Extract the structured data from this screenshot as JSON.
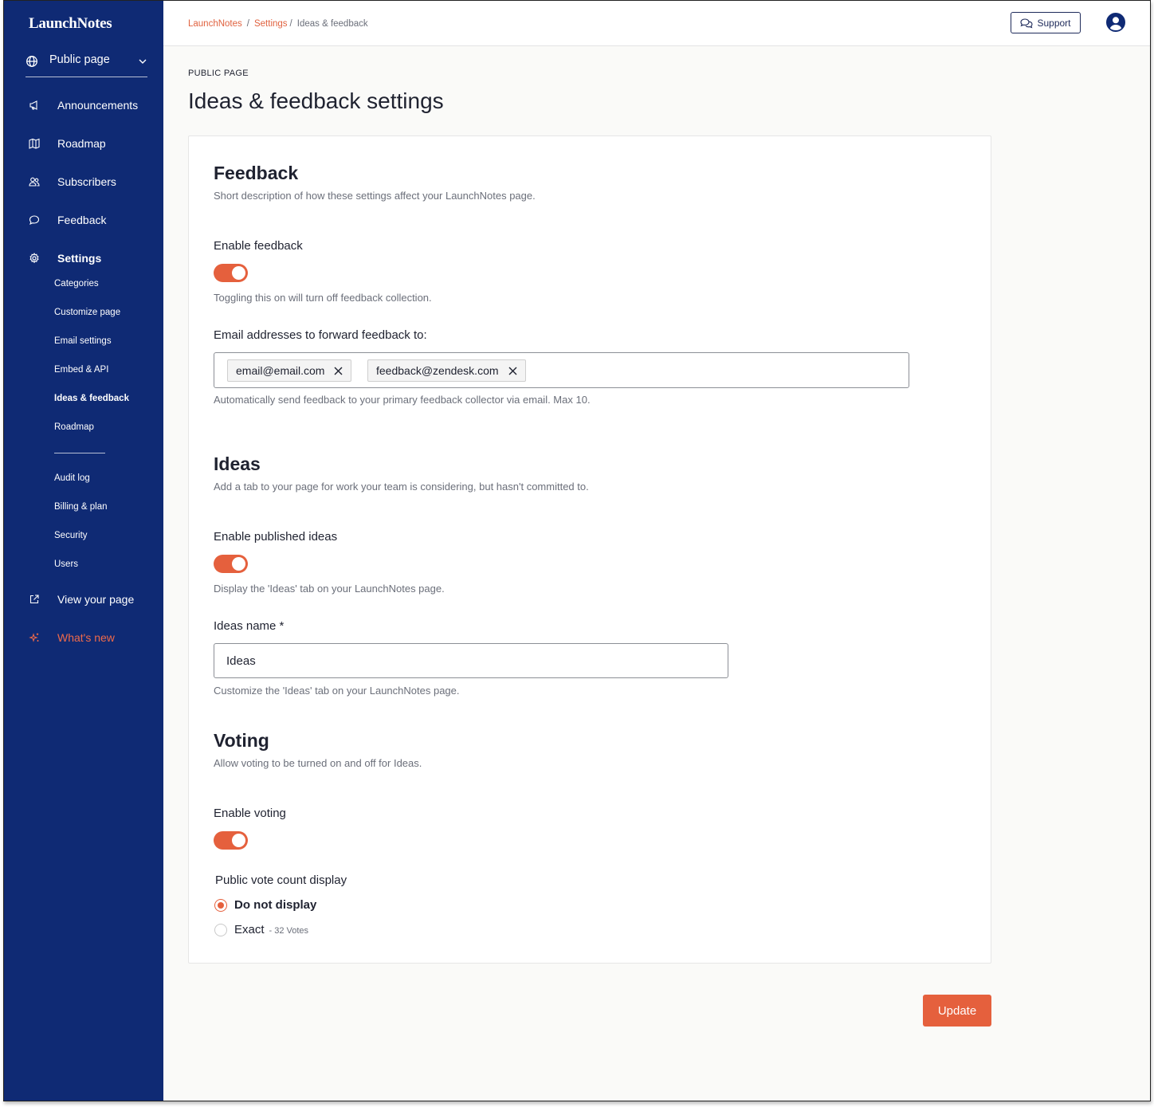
{
  "app": {
    "logo": "LaunchNotes"
  },
  "sidebar": {
    "page_select": "Public page",
    "nav": [
      {
        "label": "Announcements"
      },
      {
        "label": "Roadmap"
      },
      {
        "label": "Subscribers"
      },
      {
        "label": "Feedback"
      },
      {
        "label": "Settings"
      }
    ],
    "settings_items": [
      {
        "label": "Categories"
      },
      {
        "label": "Customize page"
      },
      {
        "label": "Email settings"
      },
      {
        "label": "Embed & API"
      },
      {
        "label": "Ideas & feedback"
      },
      {
        "label": "Roadmap"
      }
    ],
    "account_items": [
      {
        "label": "Audit log"
      },
      {
        "label": "Billing & plan"
      },
      {
        "label": "Security"
      },
      {
        "label": "Users"
      }
    ],
    "view_page": "View your page",
    "whats_new": "What's new",
    "accent_color": "#ef6a4a",
    "background_color": "#0f2a74"
  },
  "topbar": {
    "breadcrumb": [
      "LaunchNotes",
      "Settings",
      "Ideas & feedback"
    ],
    "support_label": "Support"
  },
  "main": {
    "eyebrow": "PUBLIC PAGE",
    "title": "Ideas & feedback settings"
  },
  "feedback": {
    "heading": "Feedback",
    "description": "Short description of how these settings affect your LaunchNotes page.",
    "enable_label": "Enable feedback",
    "enable_on": true,
    "enable_help": "Toggling this on will turn off feedback collection.",
    "emails_label": "Email addresses to forward feedback to:",
    "emails": [
      "email@email.com",
      "feedback@zendesk.com"
    ],
    "emails_help": "Automatically send feedback to your primary feedback collector via email. Max 10."
  },
  "ideas": {
    "heading": "Ideas",
    "description": "Add a tab to your page for work your team is considering, but hasn't committed to.",
    "enable_label": "Enable published ideas",
    "enable_on": true,
    "enable_help": "Display the 'Ideas' tab on your LaunchNotes page.",
    "name_label": "Ideas name *",
    "name_value": "Ideas",
    "name_help": "Customize the 'Ideas' tab on your LaunchNotes page."
  },
  "voting": {
    "heading": "Voting",
    "description": "Allow voting to be turned on and off for Ideas.",
    "enable_label": "Enable voting",
    "enable_on": true,
    "count_label": "Public vote count display",
    "options": [
      {
        "label": "Do not display",
        "selected": true,
        "sub": ""
      },
      {
        "label": "Exact",
        "selected": false,
        "sub": "- 32 Votes"
      }
    ]
  },
  "actions": {
    "update_label": "Update",
    "primary_color": "#e5603d"
  }
}
